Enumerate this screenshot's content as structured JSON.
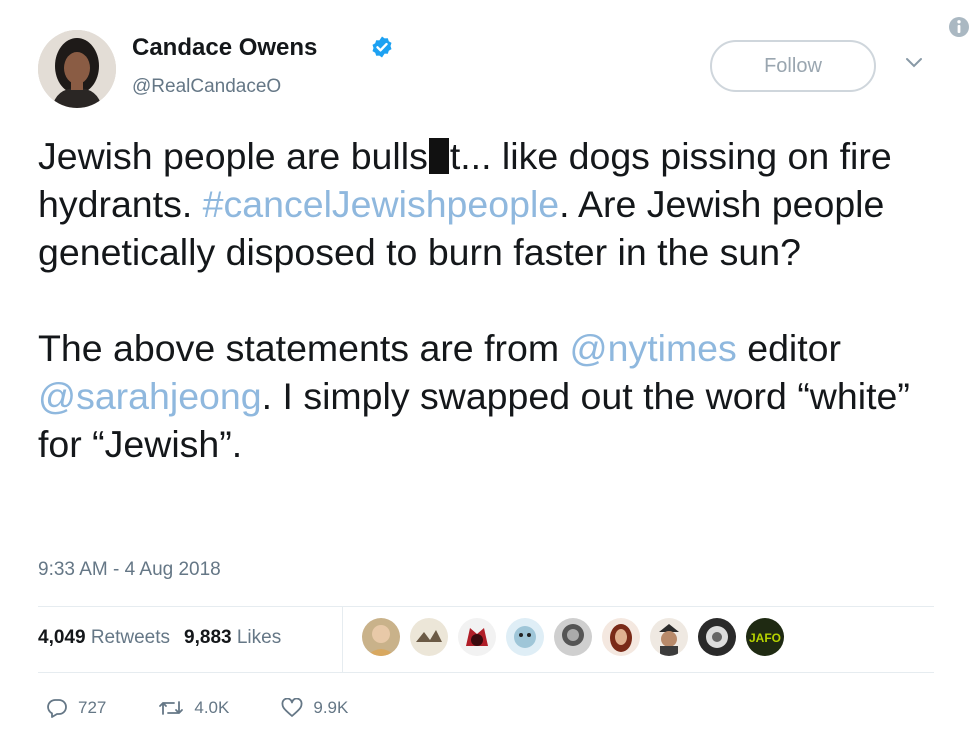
{
  "author": {
    "name": "Candace Owens",
    "handle": "@RealCandaceO",
    "avatar_icon": "avatar-photo",
    "verified_icon": "verified-badge-icon"
  },
  "follow_label": "Follow",
  "tweet": {
    "p1_a": "Jewish people are bulls",
    "p1_b": "t... like dogs pissing on fire hydrants. ",
    "p1_hashtag": "#cancelJewishpeople",
    "p1_c": ". Are Jewish people genetically disposed to burn faster in the sun?",
    "p2_a": "The above statements are from ",
    "p2_mention1": "@nytimes",
    "p2_b": " editor ",
    "p2_mention2": "@sarahjeong",
    "p2_c": ". I simply swapped out the word “white” for “Jewish”."
  },
  "timestamp": "9:33 AM - 4 Aug 2018",
  "stats": {
    "retweets_count": "4,049",
    "retweets_label": "Retweets",
    "likes_count": "9,883",
    "likes_label": "Likes"
  },
  "liker_badge_text": "JAFO",
  "actions": {
    "replies": "727",
    "retweets": "4.0K",
    "likes": "9.9K"
  },
  "colors": {
    "link": "#8fb8de",
    "verified": "#1da1f2",
    "muted": "#657786"
  }
}
